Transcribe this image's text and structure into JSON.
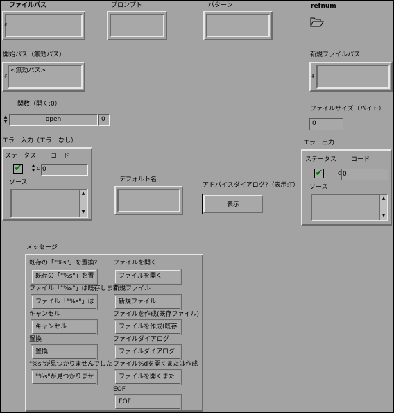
{
  "file_path": {
    "label": "ファイルパス",
    "value": ""
  },
  "prompt": {
    "label": "プロンプト",
    "value": ""
  },
  "pattern": {
    "label": "パターン",
    "value": ""
  },
  "refnum": {
    "label": "refnum",
    "icon": "folder-open-icon"
  },
  "start_path": {
    "label": "開始パス（無効パス）",
    "value": "<無効パス>"
  },
  "new_file_path": {
    "label": "新規ファイルパス",
    "value": ""
  },
  "function": {
    "label": "関数（開く:0）",
    "value": "open",
    "index": "0"
  },
  "file_size": {
    "label": "ファイルサイズ（バイト）",
    "value": "0"
  },
  "error_in": {
    "label": "エラー入力（エラーなし）",
    "status_label": "ステータス",
    "code_label": "コード",
    "code_value": "0",
    "code_prefix": "d",
    "source_label": "ソース",
    "status_glyph": "✔"
  },
  "default_name": {
    "label": "デフォルト名",
    "value": ""
  },
  "advanced_dialog": {
    "label": "アドバイスダイアログ?（表示:T）",
    "button": "表示"
  },
  "error_out": {
    "label": "エラー出力",
    "status_label": "ステータス",
    "code_label": "コード",
    "code_value": "0",
    "code_prefix": "d",
    "source_label": "ソース",
    "status_glyph": "✔"
  },
  "messages": {
    "label": "メッセージ",
    "left": [
      {
        "label": "既存の「\"%s\"」を置換?",
        "value": "既存の「\"%s\"」を置"
      },
      {
        "label": "ファイル「\"%s\"」は既存します",
        "value": "ファイル「\"%s\"」は"
      },
      {
        "label": "キャンセル",
        "value": "キャンセル"
      },
      {
        "label": "置換",
        "value": "置換"
      },
      {
        "label": "\"%s\"が見つかりませんでした",
        "value": "\"%s\"が見つかりませ"
      }
    ],
    "right": [
      {
        "label": "ファイルを開く",
        "value": "ファイルを開く"
      },
      {
        "label": "新規ファイル",
        "value": "新規ファイル"
      },
      {
        "label": "ファイルを作成(既存ファイル)",
        "value": "ファイルを作成(既存"
      },
      {
        "label": "ファイルダイアログ",
        "value": "ファイルダイアログ"
      },
      {
        "label": "ファイル%dを開くまたは作成",
        "value": "ファイルを開くまた"
      },
      {
        "label": "EOF",
        "value": "EOF"
      }
    ]
  }
}
